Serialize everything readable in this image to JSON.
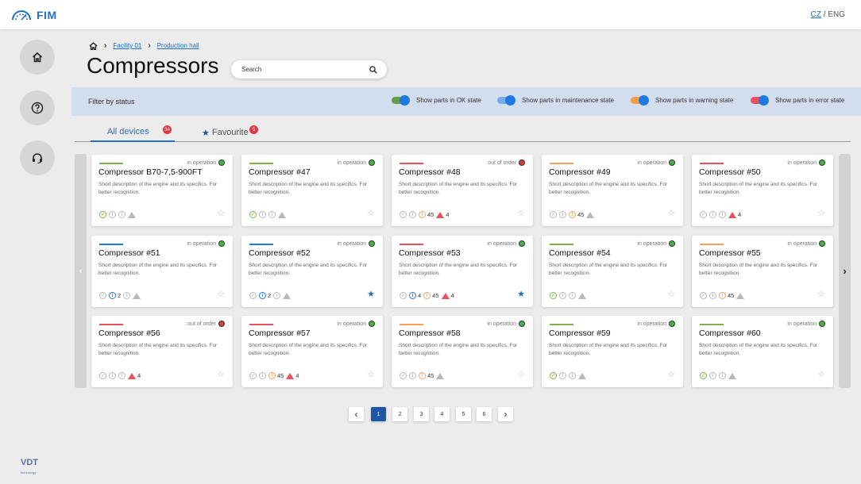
{
  "app": {
    "name": "FIM"
  },
  "lang": {
    "cz": "CZ",
    "sep": " / ",
    "eng": "ENG"
  },
  "vendor": {
    "logo": "VDT",
    "tagline": "technology"
  },
  "sidebar": [
    {
      "icon": "home-icon"
    },
    {
      "icon": "help-icon"
    },
    {
      "icon": "support-headset-icon"
    }
  ],
  "breadcrumb": {
    "items": [
      "Facility 01",
      "Production hall"
    ]
  },
  "page": {
    "title": "Compressors"
  },
  "search": {
    "placeholder": "Search"
  },
  "filter": {
    "label": "Filter by status",
    "toggles": [
      {
        "label": "Show parts in OK state",
        "color": "#6a9a4e",
        "on": true
      },
      {
        "label": "Show parts in maintenance state",
        "color": "#7aa8e8",
        "on": true
      },
      {
        "label": "Show parts in warning state",
        "color": "#f4a040",
        "on": true
      },
      {
        "label": "Show parts in error state",
        "color": "#e9505b",
        "on": true
      }
    ]
  },
  "tabs": [
    {
      "label": "All devices",
      "count": "34"
    },
    {
      "label": "Favourite",
      "count": "5",
      "icon": "star-icon"
    }
  ],
  "card_description": "Short description of the engine and its specifics. For better recognition.",
  "colors": {
    "ok": "#7cb342",
    "maintenance": "#1e7ae0",
    "warning": "#f5a15a",
    "error": "#e9505b",
    "op_dot": "#46b53f",
    "out_dot": "#d83b3b",
    "grey": "#b8b8b8"
  },
  "devices": [
    {
      "name": "Compressor B70-7,5-900FT",
      "status": "in operation",
      "line": "ok",
      "icons": {
        "ok": true,
        "maint": null,
        "warn": null,
        "err": null
      },
      "favourite": false
    },
    {
      "name": "Compressor #47",
      "status": "in operation",
      "line": "ok",
      "icons": {
        "ok": true,
        "maint": null,
        "warn": null,
        "err": null
      },
      "favourite": false
    },
    {
      "name": "Compressor #48",
      "status": "out of order",
      "line": "error",
      "icons": {
        "ok": false,
        "maint": null,
        "warn": "45",
        "err": "4"
      },
      "favourite": false
    },
    {
      "name": "Compressor #49",
      "status": "in operation",
      "line": "warning",
      "icons": {
        "ok": false,
        "maint": null,
        "warn": "45",
        "err": null
      },
      "favourite": false
    },
    {
      "name": "Compressor #50",
      "status": "in operation",
      "line": "error",
      "icons": {
        "ok": false,
        "maint": null,
        "warn": null,
        "err": "4"
      },
      "favourite": false
    },
    {
      "name": "Compressor #51",
      "status": "in operation",
      "line": "maintenance",
      "icons": {
        "ok": false,
        "maint": "2",
        "warn": null,
        "err": null
      },
      "favourite": false
    },
    {
      "name": "Compressor #52",
      "status": "in operation",
      "line": "maintenance",
      "icons": {
        "ok": false,
        "maint": "2",
        "warn": null,
        "err": null
      },
      "favourite": true
    },
    {
      "name": "Compressor #53",
      "status": "in operation",
      "line": "error",
      "icons": {
        "ok": false,
        "maint": "4",
        "warn": "45",
        "err": "4"
      },
      "favourite": true
    },
    {
      "name": "Compressor #54",
      "status": "in operation",
      "line": "ok",
      "icons": {
        "ok": true,
        "maint": null,
        "warn": null,
        "err": null
      },
      "favourite": false
    },
    {
      "name": "Compressor #55",
      "status": "in operation",
      "line": "warning",
      "icons": {
        "ok": false,
        "maint": null,
        "warn": "45",
        "err": null
      },
      "favourite": false
    },
    {
      "name": "Compressor #56",
      "status": "out of order",
      "line": "error",
      "icons": {
        "ok": false,
        "maint": null,
        "warn": null,
        "err": "4"
      },
      "favourite": false
    },
    {
      "name": "Compressor #57",
      "status": "in operation",
      "line": "error",
      "icons": {
        "ok": false,
        "maint": null,
        "warn": "45",
        "err": "4"
      },
      "favourite": false
    },
    {
      "name": "Compressor #58",
      "status": "in operation",
      "line": "warning",
      "icons": {
        "ok": false,
        "maint": null,
        "warn": "45",
        "err": null
      },
      "favourite": false
    },
    {
      "name": "Compressor #59",
      "status": "in operation",
      "line": "ok",
      "icons": {
        "ok": true,
        "maint": null,
        "warn": null,
        "err": null
      },
      "favourite": false
    },
    {
      "name": "Compressor #60",
      "status": "in operation",
      "line": "ok",
      "icons": {
        "ok": true,
        "maint": null,
        "warn": null,
        "err": null
      },
      "favourite": false
    }
  ],
  "pagination": {
    "pages": [
      "1",
      "2",
      "3",
      "4",
      "5",
      "6"
    ],
    "current": "1"
  }
}
